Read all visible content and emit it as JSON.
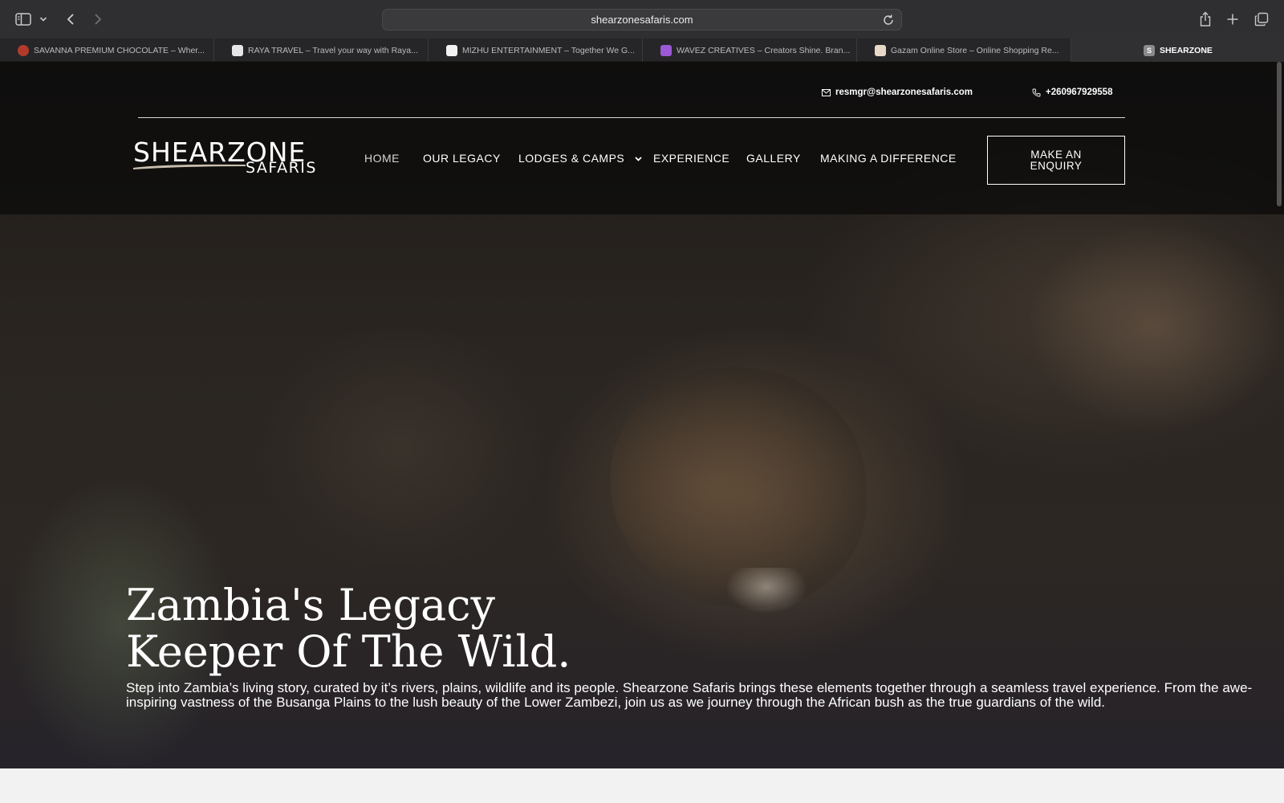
{
  "browser": {
    "url": "shearzonesafaris.com",
    "tabs": [
      {
        "label": "SAVANNA PREMIUM CHOCOLATE – Wher...",
        "favicon_color": "#b33a2a"
      },
      {
        "label": "RAYA TRAVEL – Travel your way with Raya...",
        "favicon_color": "#e6e6e6"
      },
      {
        "label": "MIZHU ENTERTAINMENT – Together We G...",
        "favicon_color": "#f2f2f2"
      },
      {
        "label": "WAVEZ CREATIVES – Creators Shine. Bran...",
        "favicon_color": "#9b59d6"
      },
      {
        "label": "Gazam Online Store – Online Shopping Re...",
        "favicon_color": "#e8d8c8"
      },
      {
        "label": "SHEARZONE",
        "favicon_letter": "S",
        "active": true
      }
    ]
  },
  "site": {
    "email": "resmgr@shearzonesafaris.com",
    "phone": "+260967929558",
    "logo_main": "SHEARZONE",
    "logo_sub": "SAFARIS",
    "nav": {
      "home": "HOME",
      "legacy": "OUR LEGACY",
      "lodges": "LODGES & CAMPS",
      "experience": "EXPERIENCE",
      "gallery": "GALLERY",
      "difference": "MAKING A DIFFERENCE"
    },
    "enquiry": "MAKE AN ENQUIRY",
    "hero": {
      "title_line1": "Zambia's Legacy",
      "title_line2": "Keeper Of The Wild.",
      "description": "Step into Zambia’s living story, curated by it’s rivers, plains, wildlife and its people. Shearzone Safaris brings these elements together through  a seamless travel experience. From the awe-inspiring vastness of the Busanga Plains to the lush beauty of the Lower Zambezi, join us as we journey through the African bush as the true guardians of the wild."
    }
  },
  "icons": {
    "sidebar": "sidebar-toggle-icon",
    "back": "back-arrow-icon",
    "forward": "forward-arrow-icon",
    "reload": "reload-icon",
    "share": "share-icon",
    "new_tab": "plus-icon",
    "tabs": "tab-overview-icon",
    "mail": "mail-icon",
    "phone": "phone-icon"
  },
  "colors": {
    "toolbar": "#2f2f31",
    "tabbar": "#262628",
    "header_overlay": "#0a0a0a",
    "text": "#ffffff"
  }
}
